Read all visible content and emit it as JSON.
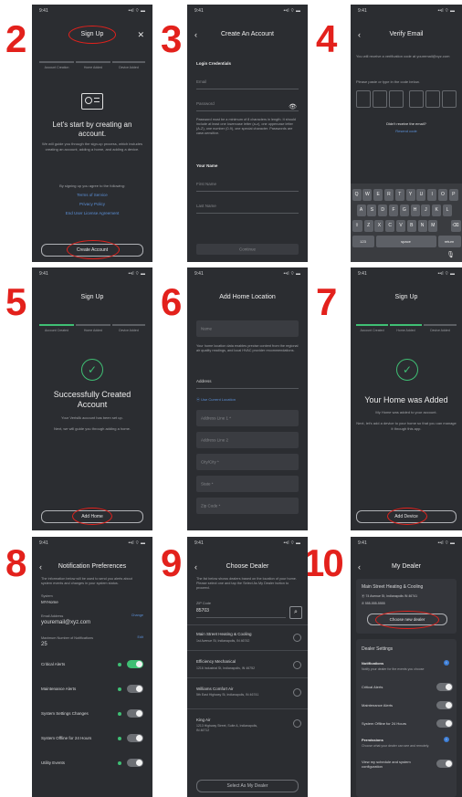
{
  "steps": [
    "2",
    "3",
    "4",
    "5",
    "6",
    "7",
    "8",
    "9",
    "10"
  ],
  "status": {
    "time": "9:41",
    "icons": "••ıl ⌔ ▬"
  },
  "s2": {
    "title": "Sign Up",
    "progress": [
      "Account Creation",
      "Home Added",
      "Device Added"
    ],
    "heading": "Let's start by creating an account.",
    "body": "We will guide you through the sign-up process, which includes creating an account, adding a home, and adding a device.",
    "agree": "By signing up you agree to the following:",
    "links": [
      "Terms of Service",
      "Privacy Policy",
      "End User License Agreement"
    ],
    "button": "Create Account"
  },
  "s3": {
    "title": "Create An Account",
    "section1": "Login Credentials",
    "email": "Email",
    "password": "Password",
    "hint": "Password must be a minimum of 8 characters in length. It should include at least one lowercase letter (a-z), one uppercase letter (A-Z), one number (0-9), one special character. Passwords are case-sensitive.",
    "section2": "Your Name",
    "first": "First Name",
    "last": "Last Name",
    "button": "Continue"
  },
  "s4": {
    "title": "Verify Email",
    "body": "You will receive a verification code at youremail@xyz.com",
    "prompt": "Please paste or type in the code below.",
    "noemail": "Didn't receive the email?",
    "resend": "Resend code",
    "rows": [
      [
        "Q",
        "W",
        "E",
        "R",
        "T",
        "Y",
        "U",
        "I",
        "O",
        "P"
      ],
      [
        "A",
        "S",
        "D",
        "F",
        "G",
        "H",
        "J",
        "K",
        "L"
      ],
      [
        "⇧",
        "Z",
        "X",
        "C",
        "V",
        "B",
        "N",
        "M",
        "⌫"
      ]
    ],
    "bottom": [
      "123",
      "space",
      "return"
    ]
  },
  "s5": {
    "title": "Sign Up",
    "progress": [
      "Account Created",
      "Home Added",
      "Device Added"
    ],
    "heading": "Successfully Created Account",
    "body1": "Your Verisilk account has been set up.",
    "body2": "Next, we will guide you through adding a home.",
    "button": "Add Home"
  },
  "s6": {
    "title": "Add Home Location",
    "name": "Name",
    "body": "Your home location data enables precise content from the regional air quality readings, and local HVAC provider recommendations.",
    "address": "Address",
    "current": "Use Current Location",
    "fields": [
      "Address Line 1 *",
      "Address Line 2",
      "City/City *",
      "State *",
      "Zip Code *"
    ]
  },
  "s7": {
    "title": "Sign Up",
    "progress": [
      "Account Created",
      "Home Added",
      "Device Added"
    ],
    "heading": "Your Home was Added",
    "body1": "My Home was added to your account.",
    "body2": "Next, let's add a device to your home so that you can manage it through this app.",
    "button": "Add Device"
  },
  "s8": {
    "title": "Notification Preferences",
    "intro": "The information below will be used to send you alerts about system events and changes in your system status.",
    "systemLabel": "System",
    "system": "MYHome",
    "emailLabel": "Email Address",
    "change": "Change",
    "email": "youremail@xyz.com",
    "maxLabel": "Maximum Number of Notifications",
    "edit": "Edit",
    "max": "25",
    "toggles": [
      "Critical Alerts",
      "Maintenance Alerts",
      "System Settings Changes",
      "System Offline for 24 Hours",
      "Utility Events"
    ]
  },
  "s9": {
    "title": "Choose Dealer",
    "intro": "The list below shows dealers based on the location of your home. Please select one and tap the Select As My Dealer button to proceed.",
    "zipLabel": "ZIP Code",
    "zip": "85703",
    "dealers": [
      {
        "name": "Main Street Heating & Cooling",
        "addr": "1st Avenue St, Indianapolis, IN 46742"
      },
      {
        "name": "Efficiency Mechanical",
        "addr": "1216 Industrial St, Indianapolis, IN 46752"
      },
      {
        "name": "Williams Comfort Air",
        "addr": "5th East Highway St, Indianapolis, IN 46741"
      },
      {
        "name": "King Air",
        "addr": "1213 Highway Street, Suite A, Indianapolis, IN 46712"
      }
    ],
    "button": "Select As My Dealer"
  },
  "s10": {
    "title": "My Dealer",
    "dealer": "Main Street Heating & Cooling",
    "addr": "74 Avenue St, Indianapolis IN 46741",
    "phone": "555-555-5555",
    "choose": "Choose new dealer",
    "settings": "Dealer Settings",
    "notif": "Notifications",
    "notifDesc": "Notify your dealer for the events you choose",
    "toggles": [
      "Critical Alerts",
      "Maintenance Alerts",
      "System Offline for 24 Hours"
    ],
    "perm": "Permissions",
    "permDesc": "Choose what your dealer can see and remotely.",
    "view": "View my schedule and system configuration"
  }
}
